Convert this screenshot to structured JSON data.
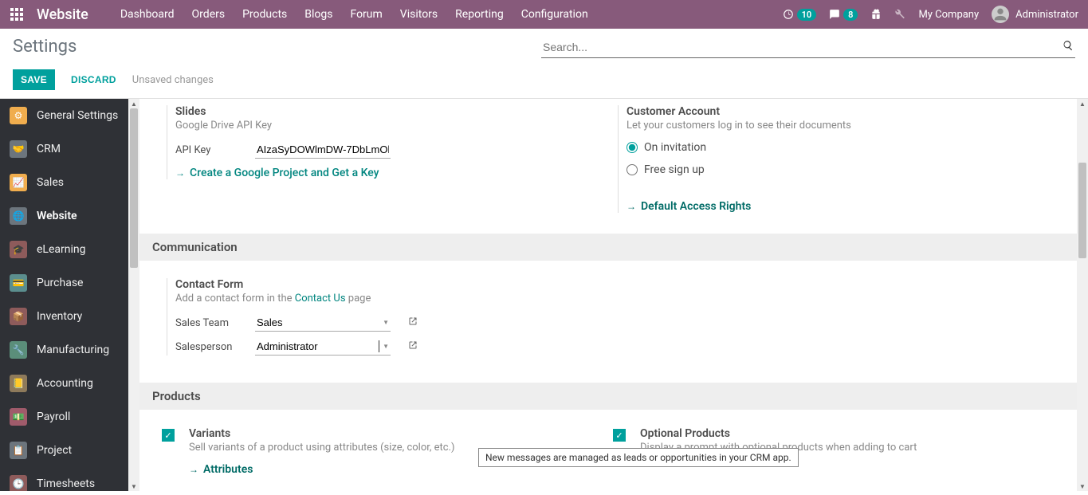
{
  "topnav": {
    "brand": "Website",
    "menu": [
      "Dashboard",
      "Orders",
      "Products",
      "Blogs",
      "Forum",
      "Visitors",
      "Reporting",
      "Configuration"
    ],
    "badge1": "10",
    "badge2": "8",
    "company": "My Company",
    "user": "Administrator"
  },
  "subhead": {
    "title": "Settings",
    "search_placeholder": "Search..."
  },
  "actions": {
    "save": "SAVE",
    "discard": "DISCARD",
    "unsaved": "Unsaved changes"
  },
  "sidebar": {
    "items": [
      {
        "label": "General Settings"
      },
      {
        "label": "CRM"
      },
      {
        "label": "Sales"
      },
      {
        "label": "Website"
      },
      {
        "label": "eLearning"
      },
      {
        "label": "Purchase"
      },
      {
        "label": "Inventory"
      },
      {
        "label": "Manufacturing"
      },
      {
        "label": "Accounting"
      },
      {
        "label": "Payroll"
      },
      {
        "label": "Project"
      },
      {
        "label": "Timesheets"
      }
    ]
  },
  "slides": {
    "title": "Slides",
    "desc": "Google Drive API Key",
    "api_key_label": "API Key",
    "api_key_value": "AIzaSyDOWlmDW-7DbLmOl",
    "create_link": "Create a Google Project and Get a Key"
  },
  "customer_account": {
    "title": "Customer Account",
    "desc": "Let your customers log in to see their documents",
    "opt1": "On invitation",
    "opt2": "Free sign up",
    "default_link": "Default Access Rights"
  },
  "sections": {
    "communication": "Communication",
    "products": "Products"
  },
  "contact_form": {
    "title": "Contact Form",
    "desc_pre": "Add a contact form in the ",
    "desc_link": "Contact Us",
    "desc_post": " page",
    "sales_team_label": "Sales Team",
    "sales_team_value": "Sales",
    "salesperson_label": "Salesperson",
    "salesperson_value": "Administrator"
  },
  "tooltip": "New messages are managed as leads or opportunities in your CRM app.",
  "variants": {
    "title": "Variants",
    "desc": "Sell variants of a product using attributes (size, color, etc.)",
    "link": "Attributes"
  },
  "optional_products": {
    "title": "Optional Products",
    "desc": "Display a prompt with optional products when adding to cart"
  }
}
